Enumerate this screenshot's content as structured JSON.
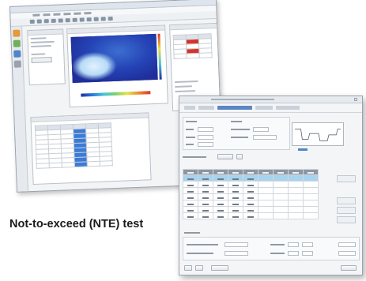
{
  "caption": "Not-to-exceed (NTE) test",
  "colors": {
    "window_background": "#f3f4f6",
    "selected_tab": "#5b86c4",
    "table_header": "#8d96a0",
    "highlighted_row": "#a6d3ee",
    "heatmap_low": "#1f2e9a",
    "heatmap_high": "#d8332a"
  },
  "back_window": {
    "panels": [
      "settings-panel",
      "heatmap-panel",
      "results-table-panel",
      "legend-table-panel"
    ],
    "left_toolbar_icons": [
      "orange-icon",
      "green-icon",
      "blue-icon",
      "gray-icon"
    ]
  },
  "front_window": {
    "sections": [
      "top-settings-group",
      "trace-preview",
      "measurement-table",
      "settings-footer"
    ]
  }
}
